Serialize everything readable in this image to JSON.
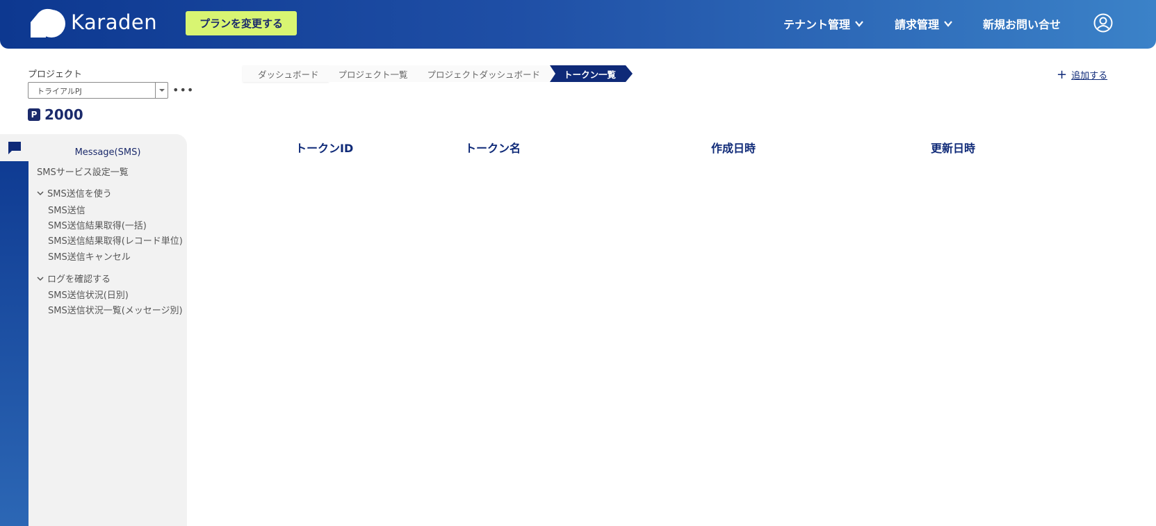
{
  "header": {
    "brand": "Karaden",
    "plan_button": "プランを変更する",
    "nav": [
      "テナント管理",
      "請求管理",
      "新規お問い合せ"
    ]
  },
  "project": {
    "label": "プロジェクト",
    "selected": "トライアルPJ",
    "more": "•••",
    "points_badge": "P",
    "points": "2000"
  },
  "sidebar": {
    "title": "Message(SMS)",
    "service_settings": "SMSサービス設定一覧",
    "groups": [
      {
        "label": "SMS送信を使う",
        "items": [
          "SMS送信",
          "SMS送信結果取得(一括)",
          "SMS送信結果取得(レコード単位)",
          "SMS送信キャンセル"
        ]
      },
      {
        "label": "ログを確認する",
        "items": [
          "SMS送信状況(日別)",
          "SMS送信状況一覧(メッセージ別)"
        ]
      }
    ]
  },
  "breadcrumb": [
    "ダッシュボード",
    "プロジェクト一覧",
    "プロジェクトダッシュボード",
    "トークン一覧"
  ],
  "add_label": "追加する",
  "table": {
    "columns": [
      "トークンID",
      "トークン名",
      "作成日時",
      "更新日時"
    ]
  },
  "colors": {
    "primary": "#0f2a78",
    "accent": "#d8f572",
    "panel": "#f2f2f2"
  }
}
